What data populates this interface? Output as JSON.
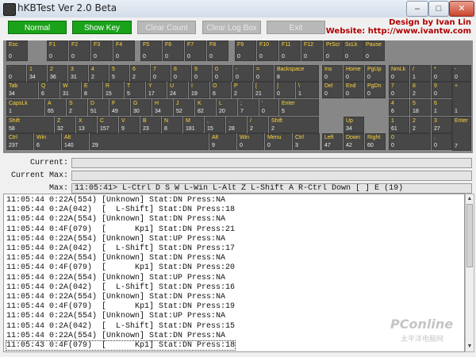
{
  "window": {
    "title": "hKBTest Ver 2.0 Beta",
    "minimize": "–",
    "maximize": "□",
    "close": "✕"
  },
  "toolbar": {
    "normal": "Normal",
    "show_key_count": "Show Key Count",
    "clear_count": "Clear Count",
    "clear_log_box": "Clear Log Box",
    "exit": "Exit",
    "credit_design": "Design by Ivan Lin",
    "credit_website": "Website: http://www.ivantw.com"
  },
  "colors": {
    "active_button": "#1aa21a",
    "disabled_button": "#b8b8b8",
    "key_bg": "#474747",
    "key_label": "#ffd43b",
    "keyboard_panel": "#878787",
    "credit_text": "#b00000"
  },
  "keys": [
    {
      "k": "Esc",
      "c": "0"
    },
    {
      "k": "F1",
      "c": "0"
    },
    {
      "k": "F2",
      "c": "0"
    },
    {
      "k": "F3",
      "c": "0"
    },
    {
      "k": "F4",
      "c": "0"
    },
    {
      "k": "F5",
      "c": "0"
    },
    {
      "k": "F6",
      "c": "0"
    },
    {
      "k": "F7",
      "c": "0"
    },
    {
      "k": "F8",
      "c": "0"
    },
    {
      "k": "F9",
      "c": "0"
    },
    {
      "k": "F10",
      "c": "0"
    },
    {
      "k": "F11",
      "c": "0"
    },
    {
      "k": "F12",
      "c": "0"
    },
    {
      "k": "PrScr",
      "c": "0"
    },
    {
      "k": "ScLk",
      "c": "0"
    },
    {
      "k": "Pause",
      "c": "0"
    },
    {
      "k": "`",
      "c": "0"
    },
    {
      "k": "1",
      "c": "34"
    },
    {
      "k": "2",
      "c": "36"
    },
    {
      "k": "3",
      "c": "31"
    },
    {
      "k": "4",
      "c": "2"
    },
    {
      "k": "5",
      "c": "5"
    },
    {
      "k": "6",
      "c": "2"
    },
    {
      "k": "7",
      "c": "0"
    },
    {
      "k": "8",
      "c": "0"
    },
    {
      "k": "9",
      "c": "0"
    },
    {
      "k": "0",
      "c": "0"
    },
    {
      "k": "-",
      "c": "0"
    },
    {
      "k": "=",
      "c": "0"
    },
    {
      "k": "Backspace",
      "c": "8"
    },
    {
      "k": "Ins",
      "c": "0"
    },
    {
      "k": "Home",
      "c": "0"
    },
    {
      "k": "PgUp",
      "c": "0"
    },
    {
      "k": "NmLk",
      "c": "0"
    },
    {
      "k": "/",
      "c": "1"
    },
    {
      "k": "*",
      "c": "0"
    },
    {
      "k": "-",
      "c": "0"
    },
    {
      "k": "Tab",
      "c": "34"
    },
    {
      "k": "Q",
      "c": "6"
    },
    {
      "k": "W",
      "c": "31"
    },
    {
      "k": "E",
      "c": "8"
    },
    {
      "k": "R",
      "c": "15"
    },
    {
      "k": "T",
      "c": "5"
    },
    {
      "k": "Y",
      "c": "17"
    },
    {
      "k": "U",
      "c": "24"
    },
    {
      "k": "I",
      "c": "19"
    },
    {
      "k": "O",
      "c": "6"
    },
    {
      "k": "P",
      "c": "2"
    },
    {
      "k": "[",
      "c": "21"
    },
    {
      "k": "]",
      "c": "0"
    },
    {
      "k": "\\",
      "c": "1"
    },
    {
      "k": "Del",
      "c": "0"
    },
    {
      "k": "End",
      "c": "0"
    },
    {
      "k": "PgDn",
      "c": "0"
    },
    {
      "k": "7",
      "c": "0"
    },
    {
      "k": "8",
      "c": "2"
    },
    {
      "k": "9",
      "c": "0"
    },
    {
      "k": "+",
      "c": "1"
    },
    {
      "k": "CapsLk",
      "c": "1"
    },
    {
      "k": "A",
      "c": "65"
    },
    {
      "k": "S",
      "c": "2"
    },
    {
      "k": "D",
      "c": "51"
    },
    {
      "k": "F",
      "c": "49"
    },
    {
      "k": "G",
      "c": "30"
    },
    {
      "k": "H",
      "c": "34"
    },
    {
      "k": "J",
      "c": "52"
    },
    {
      "k": "K",
      "c": "82"
    },
    {
      "k": "L",
      "c": "20"
    },
    {
      "k": ";",
      "c": "7"
    },
    {
      "k": "'",
      "c": "0"
    },
    {
      "k": "Enter",
      "c": "5"
    },
    {
      "k": "4",
      "c": "6"
    },
    {
      "k": "5",
      "c": "18"
    },
    {
      "k": "6",
      "c": "1"
    },
    {
      "k": "Shift",
      "c": "58"
    },
    {
      "k": "Z",
      "c": "32"
    },
    {
      "k": "X",
      "c": "13"
    },
    {
      "k": "C",
      "c": "157"
    },
    {
      "k": "V",
      "c": "9"
    },
    {
      "k": "B",
      "c": "23"
    },
    {
      "k": "N",
      "c": "8"
    },
    {
      "k": "M",
      "c": "181"
    },
    {
      "k": ",",
      "c": "15"
    },
    {
      "k": ".",
      "c": "28"
    },
    {
      "k": "/",
      "c": "2"
    },
    {
      "k": "Shift",
      "c": "2"
    },
    {
      "k": "Up",
      "c": "34"
    },
    {
      "k": "1",
      "c": "61"
    },
    {
      "k": "2",
      "c": "2"
    },
    {
      "k": "3",
      "c": "27"
    },
    {
      "k": "Enter",
      "c": "7"
    },
    {
      "k": "Ctrl",
      "c": "237"
    },
    {
      "k": "Win",
      "c": "6"
    },
    {
      "k": "Alt",
      "c": "140"
    },
    {
      "k": "",
      "c": "29"
    },
    {
      "k": "Alt",
      "c": "9"
    },
    {
      "k": "Win",
      "c": "0"
    },
    {
      "k": "Menu",
      "c": "0"
    },
    {
      "k": "Ctrl",
      "c": "3"
    },
    {
      "k": "Left",
      "c": "47"
    },
    {
      "k": "Down",
      "c": "42"
    },
    {
      "k": "Right",
      "c": "60"
    },
    {
      "k": "0",
      "c": "0"
    },
    {
      "k": ".",
      "c": "0"
    }
  ],
  "status": {
    "current_label": "Current:",
    "current_value": "",
    "current_max_label": "Current Max:",
    "current_max_value": "",
    "max_label": "Max:",
    "max_value": "11:05:41> L-Ctrl D S W L-Win L-Alt Z L-Shift A R-Ctrl Down [ ] E (19)"
  },
  "log": [
    "11:05:44 0:22A(554) [Unknown] Stat:DN Press:NA",
    "11:05:44 0:2A(042)  [  L-Shift] Stat:DN Press:18",
    "11:05:44 0:22A(554) [Unknown] Stat:DN Press:NA",
    "11:05:44 0:4F(079)  [      Kp1] Stat:DN Press:21",
    "11:05:44 0:22A(554) [Unknown] Stat:UP Press:NA",
    "11:05:44 0:2A(042)  [  L-Shift] Stat:DN Press:17",
    "11:05:44 0:22A(554) [Unknown] Stat:DN Press:NA",
    "11:05:44 0:4F(079)  [      Kp1] Stat:DN Press:20",
    "11:05:44 0:22A(554) [Unknown] Stat:UP Press:NA",
    "11:05:44 0:2A(042)  [  L-Shift] Stat:DN Press:16",
    "11:05:44 0:22A(554) [Unknown] Stat:DN Press:NA",
    "11:05:44 0:4F(079)  [      Kp1] Stat:DN Press:19",
    "11:05:44 0:22A(554) [Unknown] Stat:UP Press:NA",
    "11:05:44 0:2A(042)  [  L-Shift] Stat:DN Press:15",
    "11:05:44 0:22A(554) [Unknown] Stat:DN Press:NA",
    "11:05:43 0:4F(079)  [      Kp1] Stat:DN Press:18"
  ],
  "watermark": {
    "brand": "PConline",
    "sub": "太平洋电脑网"
  }
}
